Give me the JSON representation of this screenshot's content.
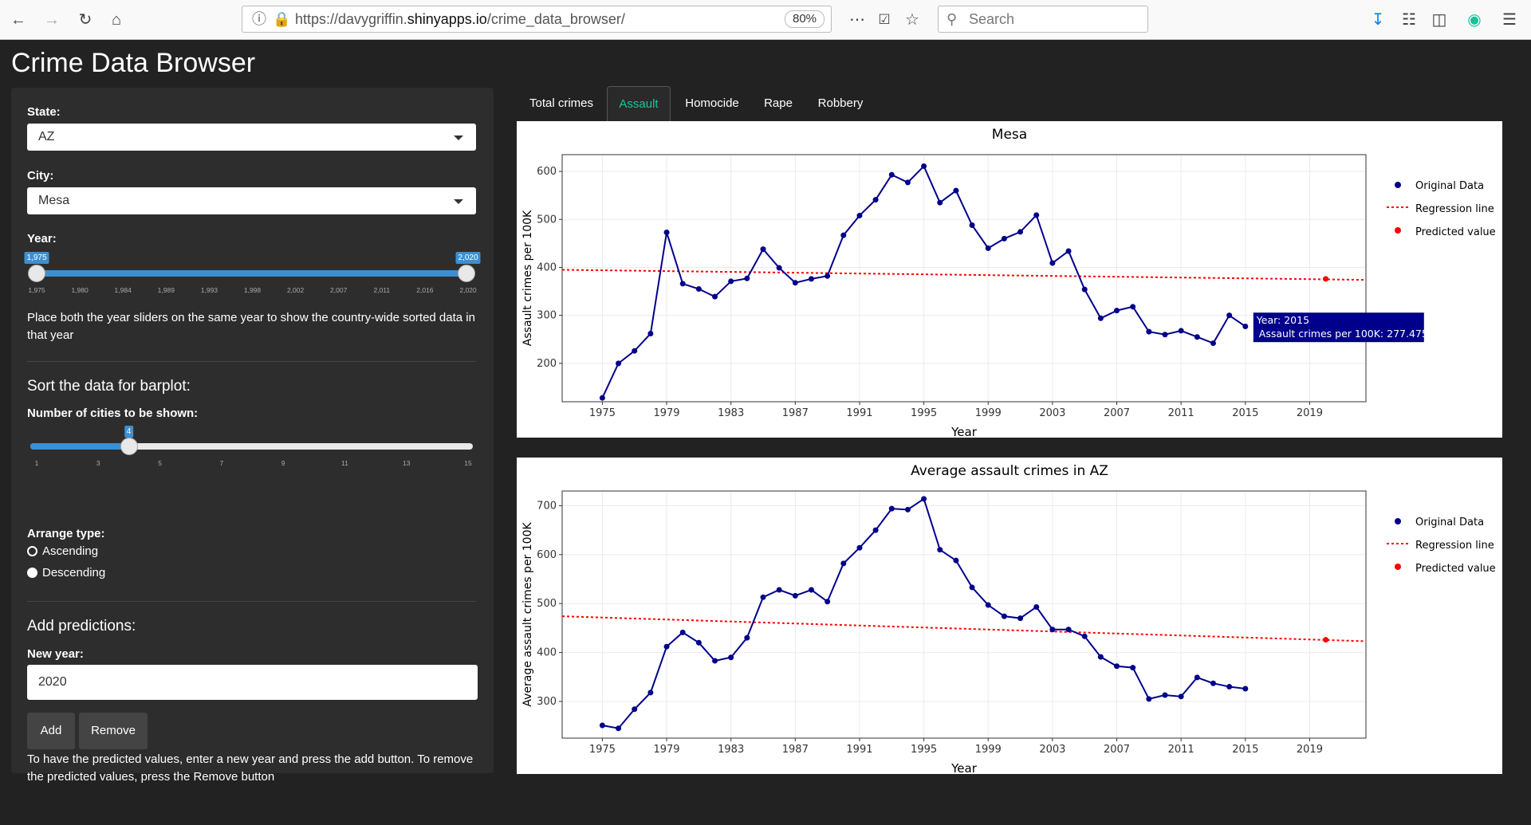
{
  "browser": {
    "url_prefix": "https://davygriffin.",
    "url_domain": "shinyapps.io",
    "url_path": "/crime_data_browser/",
    "zoom": "80%",
    "search_placeholder": "Search"
  },
  "app_title": "Crime Data Browser",
  "sidebar": {
    "state_label": "State:",
    "state_value": "AZ",
    "city_label": "City:",
    "city_value": "Mesa",
    "year_label": "Year:",
    "year_min_value": "1,975",
    "year_max_value": "2,020",
    "year_ticks": [
      "1,975",
      "1,980",
      "1,984",
      "1,989",
      "1,993",
      "1,998",
      "2,002",
      "2,007",
      "2,011",
      "2,016",
      "2,020"
    ],
    "year_help": "Place both the year sliders on the same year to show the country-wide sorted data in that year",
    "sort_header": "Sort the data for barplot:",
    "num_cities_label": "Number of cities to be shown:",
    "num_cities_value": "4",
    "num_cities_fraction": 0.2143,
    "num_ticks": [
      "1",
      "3",
      "5",
      "7",
      "9",
      "11",
      "13",
      "15"
    ],
    "arrange_label": "Arrange type:",
    "arrange_options": [
      "Ascending",
      "Descending"
    ],
    "arrange_selected": "Descending",
    "pred_header": "Add predictions:",
    "new_year_label": "New year:",
    "new_year_value": "2020",
    "add_label": "Add",
    "remove_label": "Remove",
    "pred_help": "To have the predicted values, enter a new year and press the add button. To remove the predicted values, press the Remove button"
  },
  "tabs": [
    "Total crimes",
    "Assault",
    "Homocide",
    "Rape",
    "Robbery"
  ],
  "active_tab": "Assault",
  "legend": [
    "Original Data",
    "Regression line",
    "Predicted value"
  ],
  "colors": {
    "series": "#00008b",
    "regression": "#ff0000",
    "accent": "#19c59a",
    "slider": "#3d8fd0"
  },
  "tooltip": {
    "line1": "Year:  2015",
    "line2": "Assault crimes per 100K:  277.475"
  },
  "chart_data": [
    {
      "type": "line",
      "title": "Mesa",
      "xlabel": "Year",
      "ylabel": "Assault crimes  per 100K",
      "xlim": [
        1972.5,
        2022.5
      ],
      "ylim": [
        120,
        635
      ],
      "xticks": [
        1975,
        1979,
        1983,
        1987,
        1991,
        1995,
        1999,
        2003,
        2007,
        2011,
        2015,
        2019
      ],
      "yticks": [
        200,
        300,
        400,
        500,
        600
      ],
      "x": [
        1975,
        1976,
        1977,
        1978,
        1979,
        1980,
        1981,
        1982,
        1983,
        1984,
        1985,
        1986,
        1987,
        1988,
        1989,
        1990,
        1991,
        1992,
        1993,
        1994,
        1995,
        1996,
        1997,
        1998,
        1999,
        2000,
        2001,
        2002,
        2003,
        2004,
        2005,
        2006,
        2007,
        2008,
        2009,
        2010,
        2011,
        2012,
        2013,
        2014,
        2015
      ],
      "series": [
        {
          "name": "Original Data",
          "values": [
            128,
            200,
            226,
            262,
            473,
            366,
            355,
            339,
            371,
            377,
            438,
            399,
            368,
            376,
            382,
            467,
            508,
            541,
            593,
            577,
            611,
            535,
            560,
            488,
            440,
            460,
            474,
            509,
            409,
            434,
            354,
            294,
            310,
            318,
            266,
            260,
            268,
            255,
            242,
            300,
            277
          ]
        }
      ],
      "regression": {
        "name": "Regression line",
        "y_start": 395,
        "y_end": 374
      },
      "predicted": {
        "name": "Predicted value",
        "x": 2020,
        "y": 376
      }
    },
    {
      "type": "line",
      "title": "Average assault crimes in AZ",
      "xlabel": "Year",
      "ylabel": "Average assault crimes  per 100K",
      "xlim": [
        1972.5,
        2022.5
      ],
      "ylim": [
        225,
        730
      ],
      "xticks": [
        1975,
        1979,
        1983,
        1987,
        1991,
        1995,
        1999,
        2003,
        2007,
        2011,
        2015,
        2019
      ],
      "yticks": [
        300,
        400,
        500,
        600,
        700
      ],
      "x": [
        1975,
        1976,
        1977,
        1978,
        1979,
        1980,
        1981,
        1982,
        1983,
        1984,
        1985,
        1986,
        1987,
        1988,
        1989,
        1990,
        1991,
        1992,
        1993,
        1994,
        1995,
        1996,
        1997,
        1998,
        1999,
        2000,
        2001,
        2002,
        2003,
        2004,
        2005,
        2006,
        2007,
        2008,
        2009,
        2010,
        2011,
        2012,
        2013,
        2014,
        2015
      ],
      "series": [
        {
          "name": "Original Data",
          "values": [
            251,
            245,
            284,
            318,
            412,
            441,
            420,
            383,
            390,
            430,
            513,
            528,
            516,
            528,
            504,
            582,
            614,
            650,
            694,
            692,
            714,
            610,
            588,
            533,
            497,
            474,
            470,
            493,
            447,
            447,
            433,
            391,
            372,
            369,
            305,
            313,
            310,
            349,
            337,
            330,
            326
          ]
        }
      ],
      "regression": {
        "name": "Regression line",
        "y_start": 474,
        "y_end": 423
      },
      "predicted": {
        "name": "Predicted value",
        "x": 2020,
        "y": 426
      }
    }
  ]
}
